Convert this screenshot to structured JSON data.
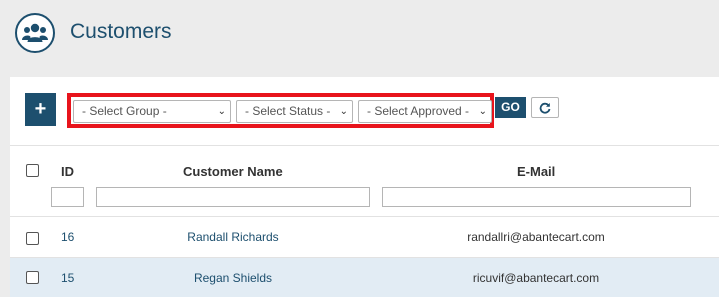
{
  "header": {
    "title": "Customers",
    "icon": "users-icon"
  },
  "toolbar": {
    "add_label": "+",
    "filters": {
      "group": "- Select Group -",
      "status": "- Select Status -",
      "approved": "- Select Approved -"
    },
    "go_label": "GO",
    "refresh_icon": "refresh-icon"
  },
  "table": {
    "columns": {
      "id": "ID",
      "name": "Customer Name",
      "email": "E-Mail"
    },
    "rows": [
      {
        "id": "16",
        "name": "Randall Richards",
        "email": "randallri@abantecart.com"
      },
      {
        "id": "15",
        "name": "Regan Shields",
        "email": "ricuvif@abantecart.com"
      }
    ]
  },
  "colors": {
    "accent": "#1d4f6e",
    "highlight": "#e8141c",
    "row_alt": "#e2ecf4"
  }
}
